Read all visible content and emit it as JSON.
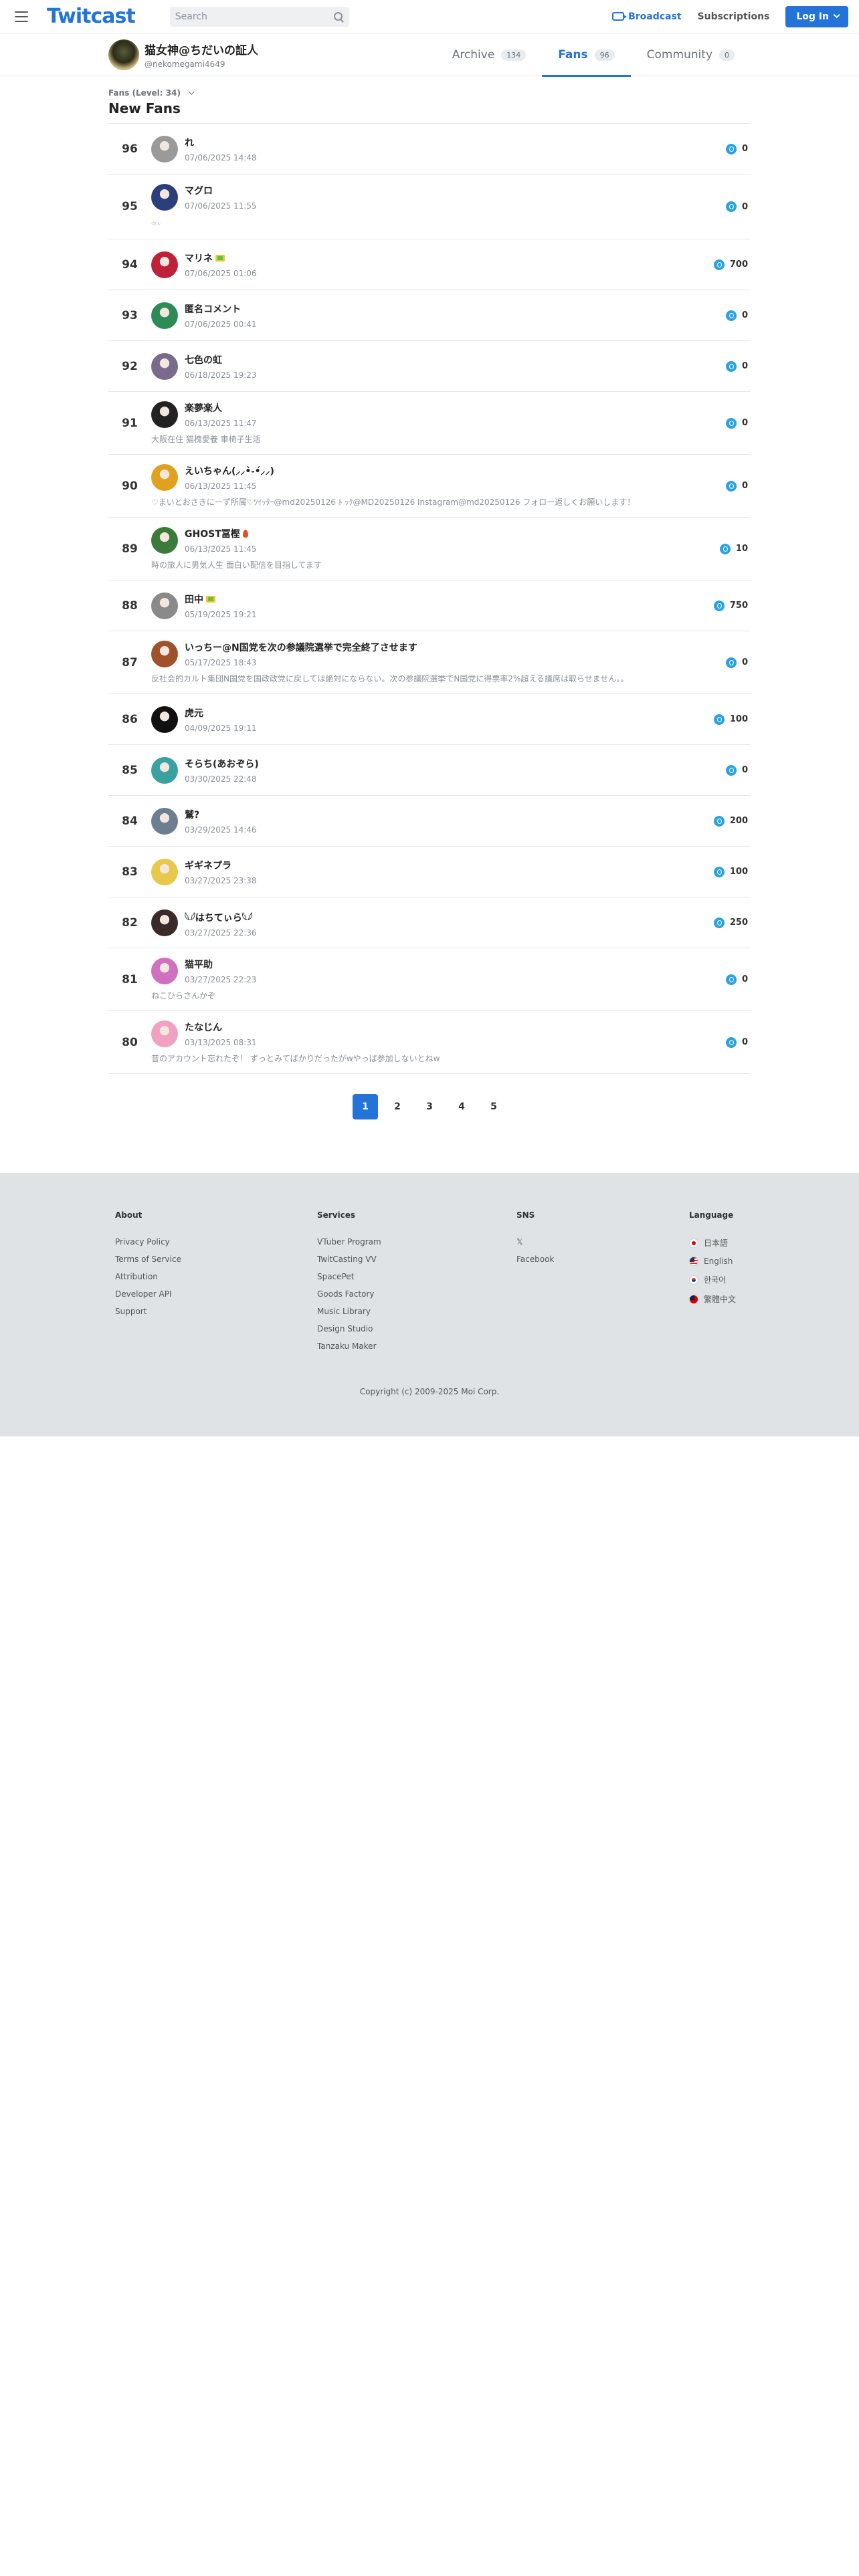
{
  "header": {
    "logo": "Twitcast",
    "search_placeholder": "Search",
    "broadcast": "Broadcast",
    "subscriptions": "Subscriptions",
    "login": "Log In"
  },
  "user": {
    "name": "猫女神@ちだいの証人",
    "id": "@nekomegami4649"
  },
  "tabs": [
    {
      "label": "Archive",
      "count": "134"
    },
    {
      "label": "Fans",
      "count": "96"
    },
    {
      "label": "Community",
      "count": "0"
    }
  ],
  "fans_level": "Fans (Level: 34)",
  "page_title": "New Fans",
  "fans": [
    {
      "rank": "96",
      "name": "れ",
      "date": "07/06/2025 14:48",
      "comment": "",
      "points": "0",
      "avatar_color": "#9a9a9a"
    },
    {
      "rank": "95",
      "name": "マグロ",
      "date": "07/06/2025 11:55",
      "comment": "𓆛",
      "points": "0",
      "avatar_color": "#2d3f7a"
    },
    {
      "rank": "94",
      "name": "マリネ",
      "date": "07/06/2025 01:06",
      "comment": "",
      "points": "700",
      "avatar_color": "#c0213a"
    },
    {
      "rank": "93",
      "name": "匿名コメント",
      "date": "07/06/2025 00:41",
      "comment": "",
      "points": "0",
      "avatar_color": "#2e8b57"
    },
    {
      "rank": "92",
      "name": "七色の虹",
      "date": "06/18/2025 19:23",
      "comment": "",
      "points": "0",
      "avatar_color": "#7a6a8c"
    },
    {
      "rank": "91",
      "name": "楽夢楽人",
      "date": "06/13/2025 11:47",
      "comment": "大阪在住 猫槐愛養 車椅子生活",
      "points": "0",
      "avatar_color": "#222222"
    },
    {
      "rank": "90",
      "name": "えいちゃん(⸝⸝•̀֊•́⸝⸝)",
      "date": "06/13/2025 11:45",
      "comment": "♡まいとおさきにーず所属♡ﾂｲｯﾀｰ@md20250126 ﾄ ｯｸ@MD20250126 Instagram@md20250126 フォロー返しくお願いします！",
      "points": "0",
      "avatar_color": "#e0a020"
    },
    {
      "rank": "89",
      "name": "GHOST冨樫",
      "date": "06/13/2025 11:45",
      "comment": "時の旅人に男気人生 面白い配信を目指してます",
      "points": "10",
      "avatar_color": "#3a7a3a"
    },
    {
      "rank": "88",
      "name": "田中",
      "date": "05/19/2025 19:21",
      "comment": "",
      "points": "750",
      "avatar_color": "#8a8a8a"
    },
    {
      "rank": "87",
      "name": "いっちー@N国党を次の参議院選挙で完全終了させます",
      "date": "05/17/2025 18:43",
      "comment": "反社会的カルト集団N国党を国政政党に戻しては絶対にならない。次の参議院選挙でN国党に得票率2%超える議席は取らせません。。",
      "points": "0",
      "avatar_color": "#a0502a"
    },
    {
      "rank": "86",
      "name": "虎元",
      "date": "04/09/2025 19:11",
      "comment": "",
      "points": "100",
      "avatar_color": "#111111"
    },
    {
      "rank": "85",
      "name": "そらち(あおぞら)",
      "date": "03/30/2025 22:48",
      "comment": "",
      "points": "0",
      "avatar_color": "#3aa0a0"
    },
    {
      "rank": "84",
      "name": "鷲?",
      "date": "03/29/2025 14:46",
      "comment": "",
      "points": "200",
      "avatar_color": "#6d7e90"
    },
    {
      "rank": "83",
      "name": "ギギネプラ",
      "date": "03/27/2025 23:38",
      "comment": "",
      "points": "100",
      "avatar_color": "#e8c84a"
    },
    {
      "rank": "82",
      "name": "𓆩𓆪はちてぃら𓆩𓆪",
      "date": "03/27/2025 22:36",
      "comment": "",
      "points": "250",
      "avatar_color": "#3a2a2a"
    },
    {
      "rank": "81",
      "name": "猫平助",
      "date": "03/27/2025 22:23",
      "comment": "ねこひらさんかぞ",
      "points": "0",
      "avatar_color": "#d070c0"
    },
    {
      "rank": "80",
      "name": "たなじん",
      "date": "03/13/2025 08:31",
      "comment": "昔のアカウント忘れたぞ！ ずっとみてばかりだったがwやっぱ参加しないとねw",
      "points": "0",
      "avatar_color": "#f0a0c0"
    }
  ],
  "pagination": [
    "1",
    "2",
    "3",
    "4",
    "5"
  ],
  "footer": {
    "about": {
      "title": "About",
      "links": [
        "Privacy Policy",
        "Terms of Service",
        "Attribution",
        "Developer API",
        "Support"
      ]
    },
    "services": {
      "title": "Services",
      "links": [
        "VTuber Program",
        "TwitCasting VV",
        "SpacePet",
        "Goods Factory",
        "Music Library",
        "Design Studio",
        "Tanzaku Maker"
      ]
    },
    "sns": {
      "title": "SNS",
      "links": [
        "𝕏",
        "Facebook"
      ]
    },
    "language": {
      "title": "Language",
      "links": [
        "日本語",
        "English",
        "한국어",
        "繁體中文"
      ]
    },
    "copyright": "Copyright (c) 2009-2025 Moi Corp."
  }
}
